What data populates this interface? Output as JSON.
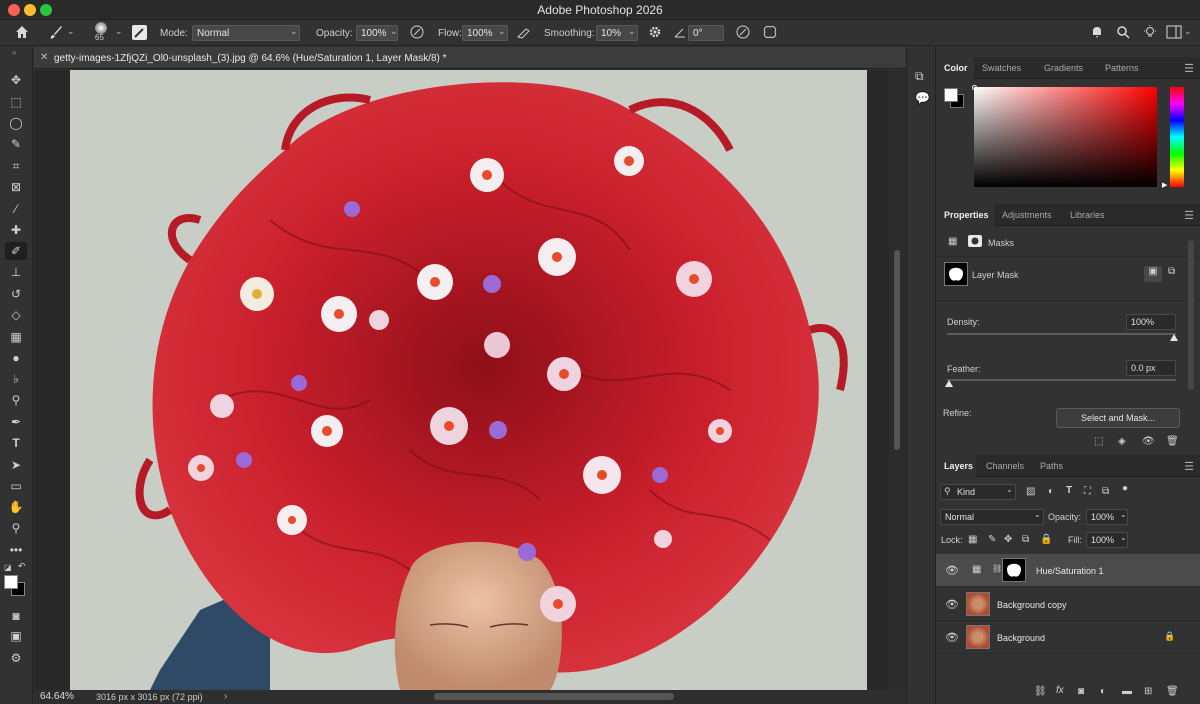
{
  "window": {
    "title": "Adobe Photoshop 2026"
  },
  "options_bar": {
    "brush_size": "65",
    "mode_label": "Mode:",
    "mode_value": "Normal",
    "opacity_label": "Opacity:",
    "opacity_value": "100%",
    "flow_label": "Flow:",
    "flow_value": "100%",
    "smoothing_label": "Smoothing:",
    "smoothing_value": "10%",
    "angle_value": "0°"
  },
  "document": {
    "tab_title": "getty-images-1ZfjQZi_Ol0-unsplash_(3).jpg @ 64.6% (Hue/Saturation 1, Layer Mask/8) *",
    "zoom": "64.64%",
    "dimensions": "3016 px x 3016 px (72 ppi)"
  },
  "color_panel": {
    "tabs": [
      "Color",
      "Swatches",
      "Gradients",
      "Patterns"
    ],
    "hue_fraction": 0.0
  },
  "properties_panel": {
    "tabs": [
      "Properties",
      "Adjustments",
      "Libraries"
    ],
    "section": "Masks",
    "mask_label": "Layer Mask",
    "density_label": "Density:",
    "density_value": "100%",
    "density_fraction": 1.0,
    "feather_label": "Feather:",
    "feather_value": "0.0 px",
    "feather_fraction": 0.0,
    "refine_label": "Refine:",
    "select_mask_button": "Select and Mask..."
  },
  "layers_panel": {
    "tabs": [
      "Layers",
      "Channels",
      "Paths"
    ],
    "filter_kind": "Kind",
    "blend_mode": "Normal",
    "opacity_label": "Opacity:",
    "opacity_value": "100%",
    "lock_label": "Lock:",
    "fill_label": "Fill:",
    "fill_value": "100%",
    "layers": [
      {
        "name": "Hue/Saturation 1",
        "selected": true
      },
      {
        "name": "Background copy",
        "selected": false
      },
      {
        "name": "Background",
        "selected": false,
        "locked": true
      }
    ]
  },
  "colors": {
    "foreground": "#ffffff",
    "background": "#000000",
    "hair": "#c8202c",
    "image_bg": "#c6cbc4"
  },
  "icons": {
    "toolbar": [
      "move-icon",
      "marquee-icon",
      "lasso-icon",
      "quick-select-icon",
      "crop-icon",
      "frame-icon",
      "eyedropper-icon",
      "healing-icon",
      "brush-icon",
      "stamp-icon",
      "history-brush-icon",
      "eraser-icon",
      "gradient-icon",
      "blur-icon",
      "dodge-icon",
      "pen-icon",
      "type-icon",
      "path-select-icon",
      "rectangle-icon",
      "hand-icon",
      "zoom-icon",
      "more-tools-icon"
    ]
  }
}
